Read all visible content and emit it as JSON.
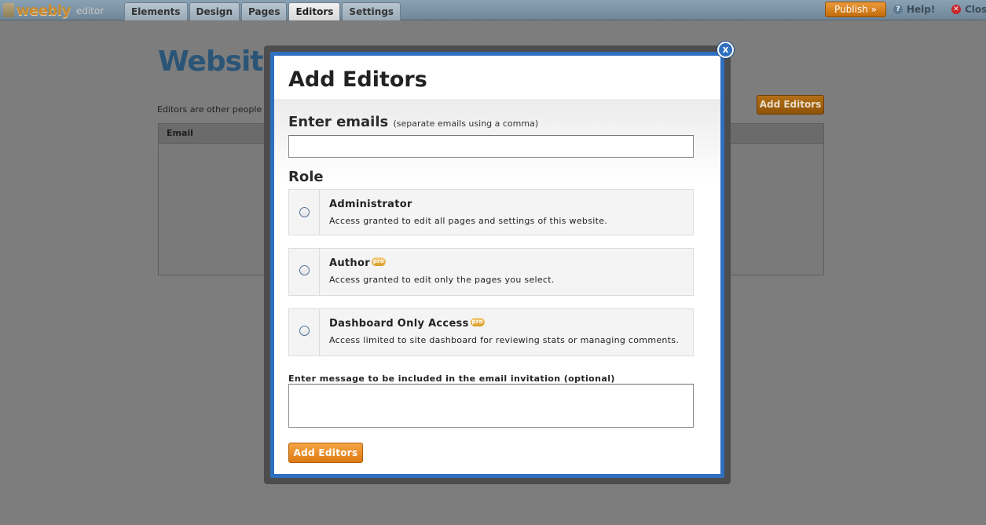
{
  "app": {
    "logo_text": "weebly",
    "logo_sub": "editor"
  },
  "nav": {
    "tabs": [
      {
        "label": "Elements"
      },
      {
        "label": "Design"
      },
      {
        "label": "Pages"
      },
      {
        "label": "Editors",
        "active": true
      },
      {
        "label": "Settings"
      }
    ],
    "publish_label": "Publish »",
    "help_label": "Help!",
    "close_label": "Close"
  },
  "background_page": {
    "title": "Website",
    "description": "Editors are other people you",
    "add_button_label": "Add Editors",
    "table_header_email": "Email"
  },
  "modal": {
    "title": "Add Editors",
    "close_icon": "x",
    "emails": {
      "label": "Enter emails",
      "hint": "(separate emails using a comma)",
      "value": ""
    },
    "role_label": "Role",
    "roles": [
      {
        "title": "Administrator",
        "description": "Access granted to edit all pages and settings of this website.",
        "pro": false,
        "selected": false
      },
      {
        "title": "Author",
        "description": "Access granted to edit only the pages you select.",
        "pro": true,
        "selected": false
      },
      {
        "title": "Dashboard Only Access",
        "description": "Access limited to site dashboard for reviewing stats or managing comments.",
        "pro": true,
        "selected": false
      }
    ],
    "pro_badge": "pro",
    "message": {
      "label": "Enter message to be included in the email invitation (optional)",
      "value": ""
    },
    "submit_label": "Add Editors"
  },
  "colors": {
    "overlay": "#7d7d7d",
    "modal_border": "#2e6fc0",
    "accent_orange": "#e58a22"
  }
}
